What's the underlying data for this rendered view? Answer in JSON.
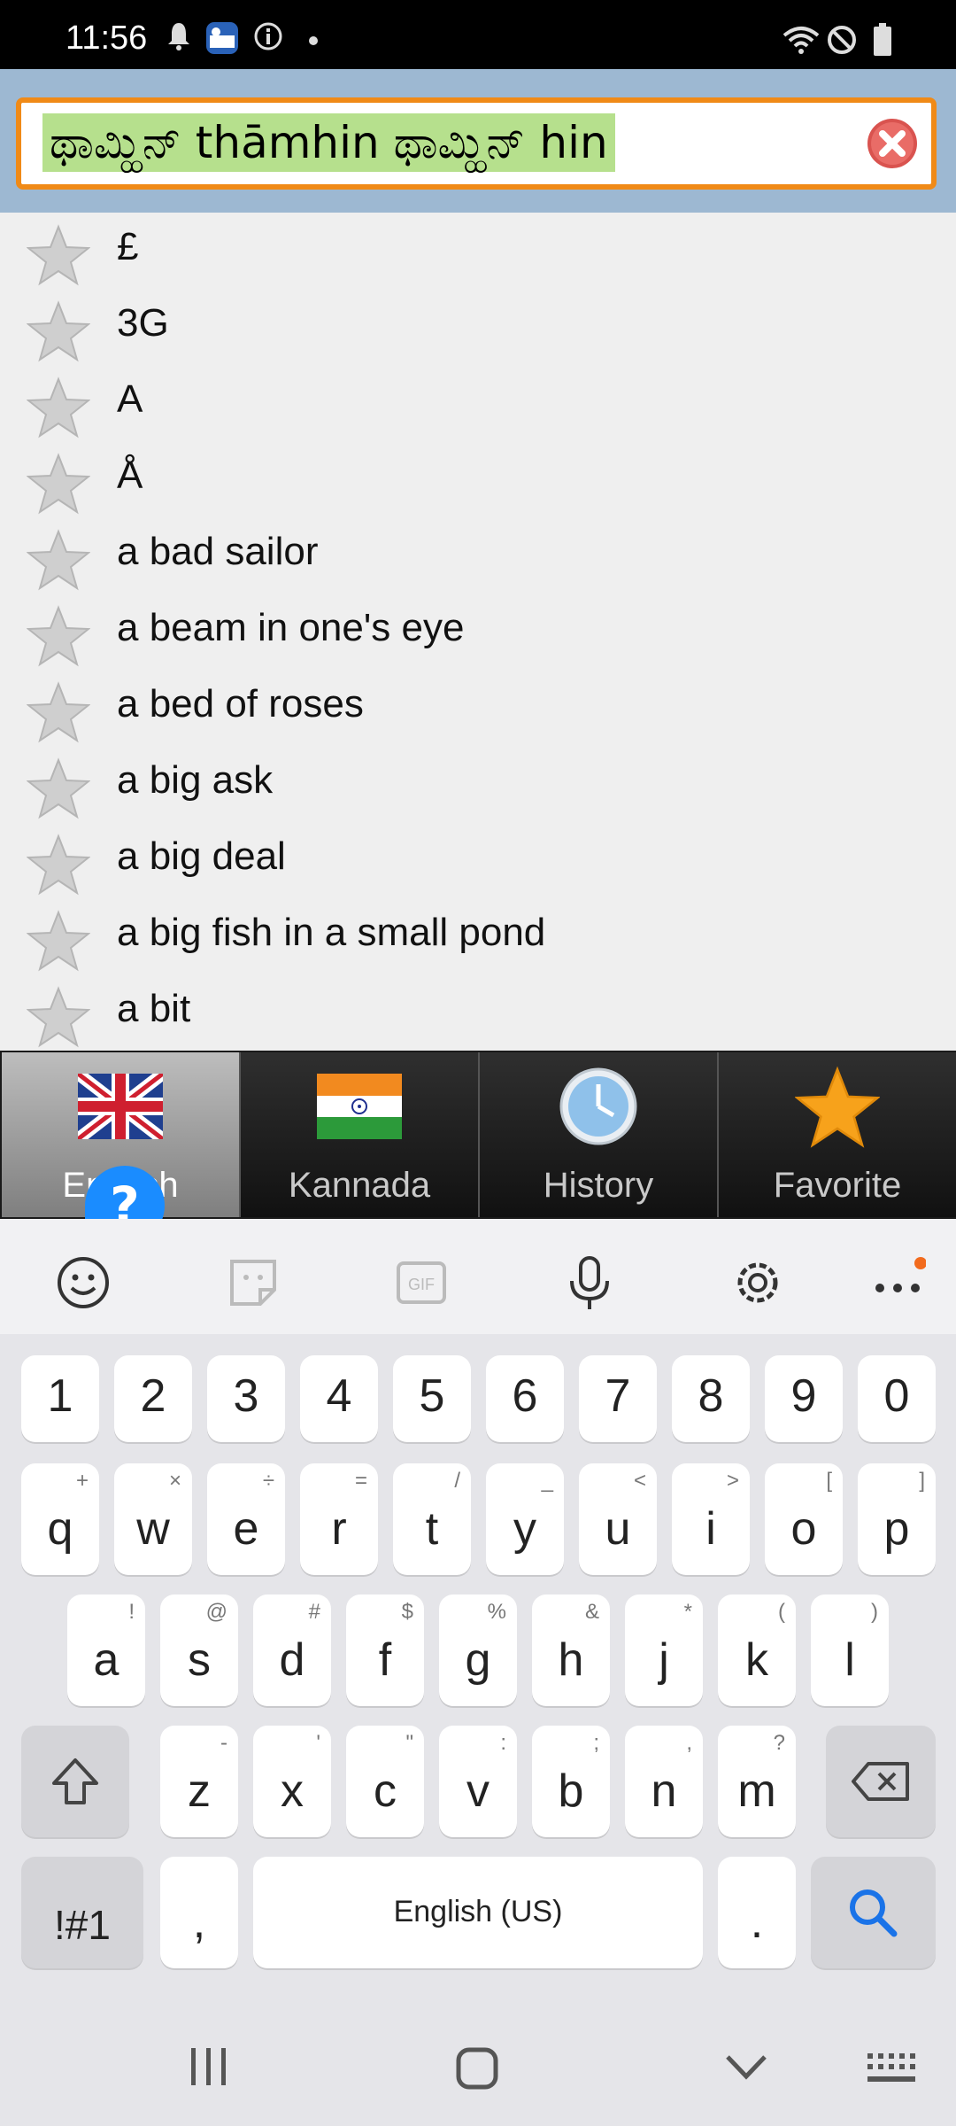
{
  "status": {
    "time": "11:56"
  },
  "search": {
    "query": "ಥಾಮ್ಹಿನ್ thāmhin ಥಾಮ್ಹಿನ್ hin"
  },
  "list": {
    "items": [
      {
        "label": "£"
      },
      {
        "label": "3G"
      },
      {
        "label": "A"
      },
      {
        "label": "Å"
      },
      {
        "label": "a bad sailor"
      },
      {
        "label": "a beam in one's eye"
      },
      {
        "label": "a bed of roses"
      },
      {
        "label": "a big ask"
      },
      {
        "label": "a big deal"
      },
      {
        "label": "a big fish in a small pond"
      },
      {
        "label": "a bit"
      }
    ]
  },
  "tabs": [
    {
      "label": "English",
      "icon": "uk-flag-icon",
      "active": true
    },
    {
      "label": "Kannada",
      "icon": "india-flag-icon",
      "active": false
    },
    {
      "label": "History",
      "icon": "clock-icon",
      "active": false
    },
    {
      "label": "Favorite",
      "icon": "star-icon",
      "active": false
    }
  ],
  "help": {
    "label": "?"
  },
  "keyboard": {
    "numbers": [
      "1",
      "2",
      "3",
      "4",
      "5",
      "6",
      "7",
      "8",
      "9",
      "0"
    ],
    "row1": [
      {
        "k": "q",
        "h": "+"
      },
      {
        "k": "w",
        "h": "×"
      },
      {
        "k": "e",
        "h": "÷"
      },
      {
        "k": "r",
        "h": "="
      },
      {
        "k": "t",
        "h": "/"
      },
      {
        "k": "y",
        "h": "_"
      },
      {
        "k": "u",
        "h": "<"
      },
      {
        "k": "i",
        "h": ">"
      },
      {
        "k": "o",
        "h": "["
      },
      {
        "k": "p",
        "h": "]"
      }
    ],
    "row2": [
      {
        "k": "a",
        "h": "!"
      },
      {
        "k": "s",
        "h": "@"
      },
      {
        "k": "d",
        "h": "#"
      },
      {
        "k": "f",
        "h": "$"
      },
      {
        "k": "g",
        "h": "%"
      },
      {
        "k": "h",
        "h": "&"
      },
      {
        "k": "j",
        "h": "*"
      },
      {
        "k": "k",
        "h": "("
      },
      {
        "k": "l",
        "h": ")"
      }
    ],
    "row3": [
      {
        "k": "z",
        "h": "-"
      },
      {
        "k": "x",
        "h": "'"
      },
      {
        "k": "c",
        "h": "\""
      },
      {
        "k": "v",
        "h": ":"
      },
      {
        "k": "b",
        "h": ";"
      },
      {
        "k": "n",
        "h": ","
      },
      {
        "k": "m",
        "h": "?"
      }
    ],
    "symbols_label": "!#1",
    "comma_label": ",",
    "space_label": "English (US)",
    "period_label": "."
  },
  "colors": {
    "accent_orange": "#f08a17",
    "search_highlight": "#b6e08d",
    "help_blue": "#1a8cff",
    "header_bg": "#9db8d2"
  }
}
